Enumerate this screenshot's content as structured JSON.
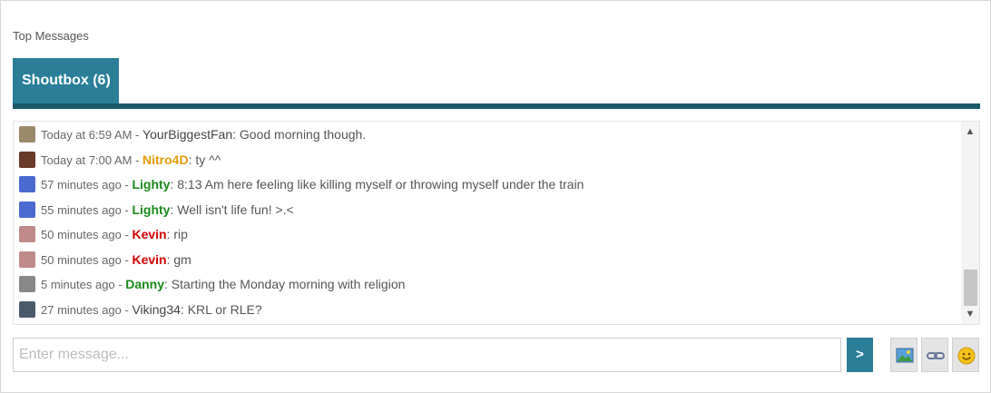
{
  "section": {
    "title": "Top Messages"
  },
  "tab": {
    "label": "Shoutbox (6)"
  },
  "colors": {
    "accent": "#2a7e98",
    "accent_dark": "#1c5a6a",
    "orange": "#e59a06",
    "green": "#1a8a1a",
    "red": "#d00000"
  },
  "messages": [
    {
      "time": "Today at 6:59 AM",
      "sep": " - ",
      "user": "YourBiggestFan",
      "user_color": "#444444",
      "bold": false,
      "text": ": Good morning though.",
      "avatar": "avatar-goat-icon",
      "avatar_color": "#9a8a6a"
    },
    {
      "time": "Today at 7:00 AM",
      "sep": " - ",
      "user": "Nitro4D",
      "user_color": "#e59a06",
      "bold": true,
      "text": ": ty ^^",
      "avatar": "avatar-dark-icon",
      "avatar_color": "#6a3a2a"
    },
    {
      "time": "57 minutes ago",
      "sep": " - ",
      "user": "Lighty",
      "user_color": "#1a8a1a",
      "bold": true,
      "text": ": 8:13 Am here feeling like killing myself or throwing myself under the train",
      "avatar": "avatar-pony-icon",
      "avatar_color": "#4a6ad0"
    },
    {
      "time": "55 minutes ago",
      "sep": " - ",
      "user": "Lighty",
      "user_color": "#1a8a1a",
      "bold": true,
      "text": ": Well isn't life fun! >.<",
      "avatar": "avatar-pony-icon",
      "avatar_color": "#4a6ad0"
    },
    {
      "time": "50 minutes ago",
      "sep": " - ",
      "user": "Kevin",
      "user_color": "#d00000",
      "bold": true,
      "text": ": rip",
      "avatar": "avatar-face-icon",
      "avatar_color": "#c08a8a"
    },
    {
      "time": "50 minutes ago",
      "sep": " - ",
      "user": "Kevin",
      "user_color": "#d00000",
      "bold": true,
      "text": ": gm",
      "avatar": "avatar-face-icon",
      "avatar_color": "#c08a8a"
    },
    {
      "time": "5 minutes ago",
      "sep": " - ",
      "user": "Danny",
      "user_color": "#1a8a1a",
      "bold": true,
      "text": ": Starting the Monday morning with religion",
      "avatar": "avatar-snowman-icon",
      "avatar_color": "#888888"
    },
    {
      "time": "27 minutes ago",
      "sep": " - ",
      "user": "Viking34",
      "user_color": "#444444",
      "bold": false,
      "text": ": KRL or RLE?",
      "avatar": "avatar-viking-icon",
      "avatar_color": "#4a5a6a"
    }
  ],
  "input": {
    "placeholder": "Enter message...",
    "value": ""
  },
  "send": {
    "label": ">"
  },
  "tools": [
    {
      "icon": "insert-image-icon"
    },
    {
      "icon": "insert-link-icon"
    },
    {
      "icon": "emoji-smiley-icon"
    }
  ]
}
